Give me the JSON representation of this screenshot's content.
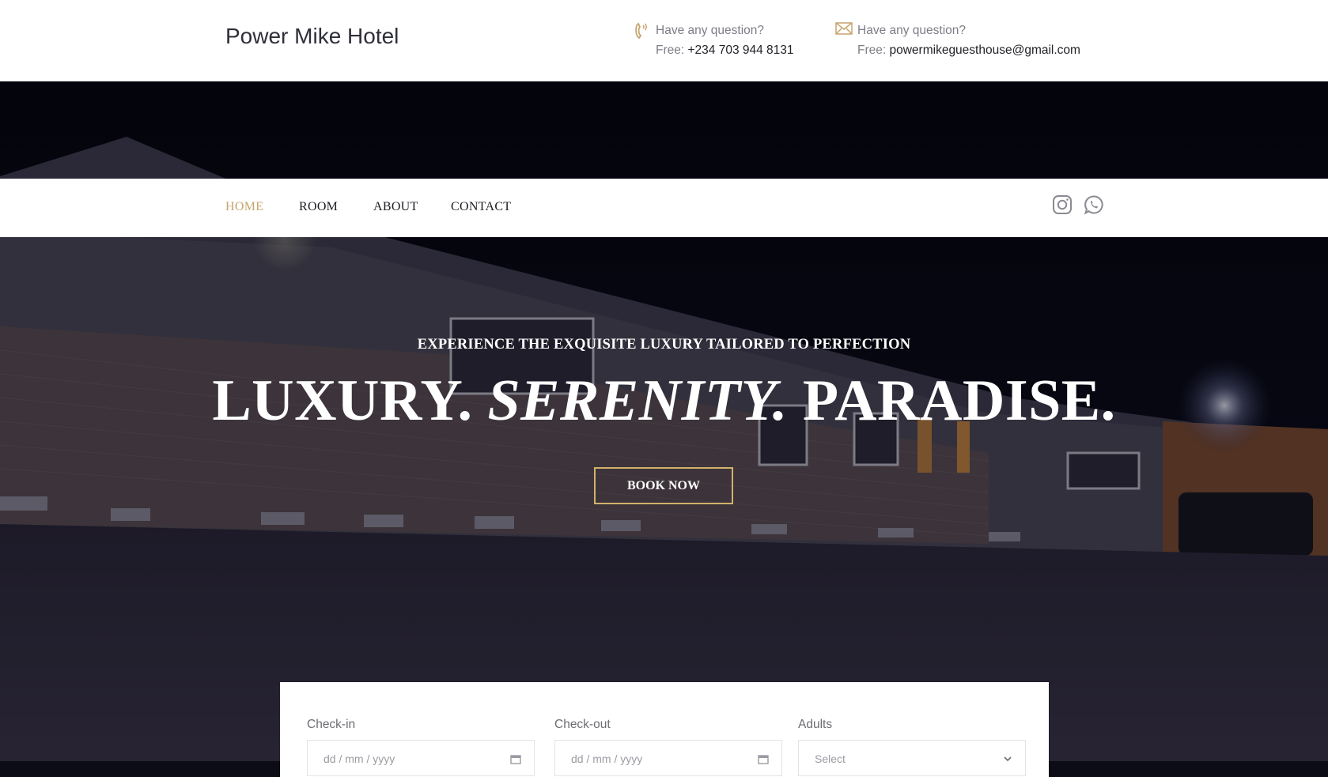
{
  "header": {
    "brand": "Power Mike Hotel",
    "phone": {
      "question": "Have any question?",
      "prefix": "Free:",
      "value": "+234 703 944 8131",
      "icon": "phone-icon"
    },
    "email": {
      "question": "Have any question?",
      "prefix": "Free:",
      "value": "powermikeguesthouse@gmail.com",
      "icon": "mail-icon"
    }
  },
  "nav": {
    "items": [
      {
        "label": "HOME",
        "active": true
      },
      {
        "label": "ROOM",
        "active": false
      },
      {
        "label": "ABOUT",
        "active": false
      },
      {
        "label": "CONTACT",
        "active": false
      }
    ],
    "social": [
      "instagram-icon",
      "whatsapp-icon"
    ]
  },
  "hero": {
    "tagline": "EXPERIENCE THE EXQUISITE LUXURY TAILORED TO PERFECTION",
    "headline_part1": "LUXURY.",
    "headline_part2": "SERENITY.",
    "headline_part3": "PARADISE.",
    "cta": "BOOK NOW"
  },
  "booking": {
    "checkin": {
      "label": "Check-in",
      "placeholder": "dd / mm / yyyy"
    },
    "checkout": {
      "label": "Check-out",
      "placeholder": "dd / mm / yyyy"
    },
    "adults": {
      "label": "Adults",
      "value": "Select"
    }
  },
  "colors": {
    "accent": "#c5a46d",
    "button_border": "#d3b06c",
    "text_dark": "#1c1c22"
  }
}
